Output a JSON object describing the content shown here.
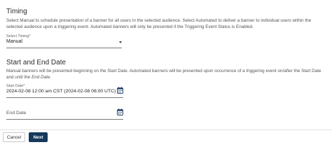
{
  "timing": {
    "title": "Timing",
    "description": "Select Manual to schedule presentation of a banner for all users in the selected audience. Select Automated to deliver a banner to individual users within the selected audience upon a triggering event. Automated banners will only be presented if the Triggering Event Status is Enabled.",
    "select_label": "Select Timing*",
    "select_value": "Manual"
  },
  "dates": {
    "title": "Start and End Date",
    "description_prefix": "Manual banners will be presented beginning on the Start Date. Automated banners will be presented upon occurrence of a triggering event on/after the Start Date and until the ",
    "description_em": "End Date",
    "description_suffix": ".",
    "start_label": "Start Date*",
    "start_value": "2024-02-08 12:00 am CST (2024-02-08 06:00 UTC)",
    "end_placeholder": "End Date"
  },
  "footer": {
    "cancel_label": "Cancel",
    "next_label": "Next"
  },
  "colors": {
    "primary": "#16385a",
    "icon": "#1f3f66"
  },
  "icons": {
    "select_caret": "chevron-down-icon",
    "calendar": "calendar-icon"
  }
}
